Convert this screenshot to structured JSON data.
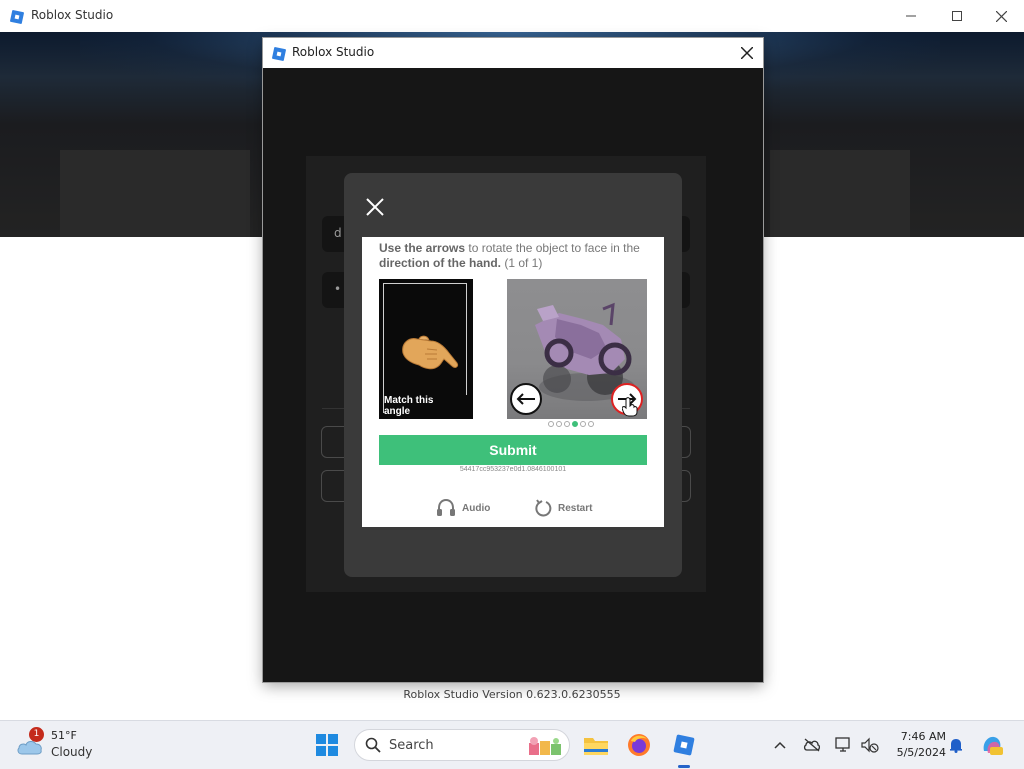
{
  "window": {
    "title": "Roblox Studio",
    "minimize_icon": "minimize-icon",
    "maximize_icon": "maximize-icon",
    "close_icon": "close-icon"
  },
  "dialog": {
    "title": "Roblox Studio",
    "close_icon": "close-icon"
  },
  "captcha": {
    "close_icon": "close-x-icon",
    "instruction": {
      "part1": "Use the arrows",
      "part2": " to rotate the object to face in the ",
      "part3": "direction of the hand.",
      "part4": " (1 of 1)"
    },
    "reference_caption_line1": "Match this",
    "reference_caption_line2": "angle",
    "left_arrow_icon": "arrow-left-icon",
    "right_arrow_icon": "arrow-right-icon",
    "progress": {
      "total": 6,
      "active_index": 3
    },
    "submit_label": "Submit",
    "session_id": "54417cc953237e0d1.0846100101",
    "audio_label": "Audio",
    "restart_label": "Restart",
    "accent_color": "#3ec07a"
  },
  "version_text": "Roblox Studio Version 0.623.0.6230555",
  "taskbar": {
    "weather_temp": "51°F",
    "weather_condition": "Cloudy",
    "weather_badge": "1",
    "search_label": "Search",
    "time": "7:46 AM",
    "date": "5/5/2024"
  }
}
